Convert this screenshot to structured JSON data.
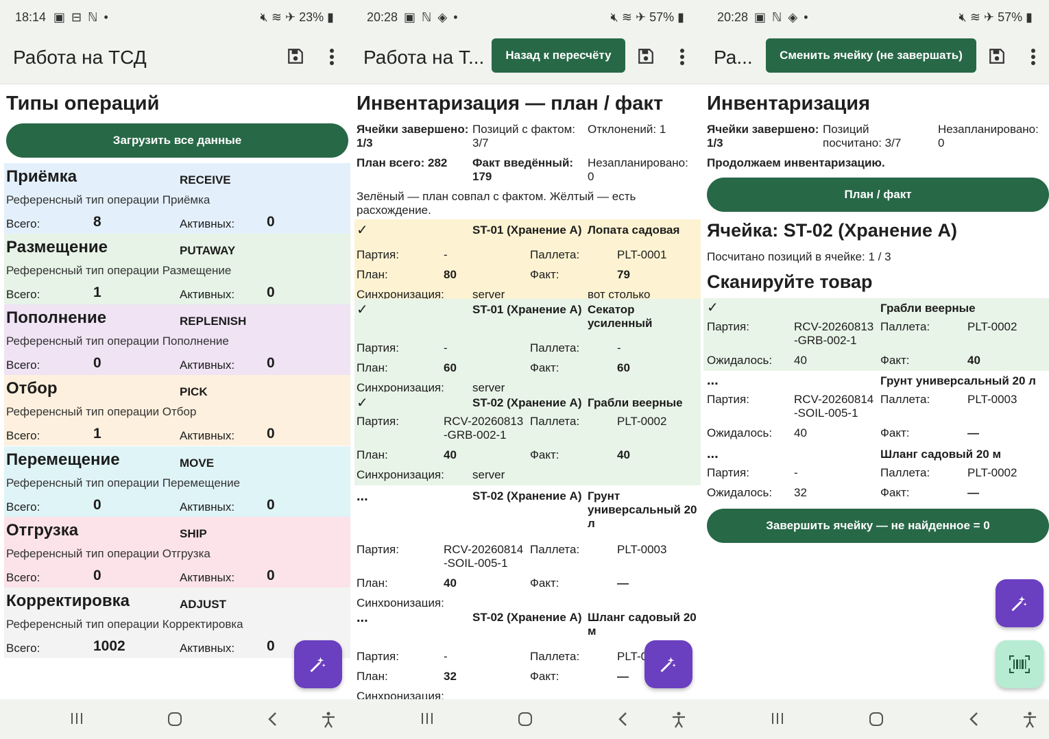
{
  "status": {
    "s1": {
      "time": "18:14",
      "battery": "23%"
    },
    "s2": {
      "time": "20:28",
      "battery": "57%"
    },
    "s3": {
      "time": "20:28",
      "battery": "57%"
    }
  },
  "screen1": {
    "title": "Работа на ТСД",
    "heading": "Типы операций",
    "load_button": "Загрузить все данные",
    "total_label": "Всего:",
    "active_label": "Активных:",
    "ops": [
      {
        "name": "Приёмка",
        "code": "RECEIVE",
        "desc": "Референсный тип операции Приёмка",
        "total": "8",
        "active": "0",
        "color": "#e3f0fb"
      },
      {
        "name": "Размещение",
        "code": "PUTAWAY",
        "desc": "Референсный тип операции Размещение",
        "total": "1",
        "active": "0",
        "color": "#e6f3e6"
      },
      {
        "name": "Пополнение",
        "code": "REPLENISH",
        "desc": "Референсный тип операции Пополнение",
        "total": "0",
        "active": "0",
        "color": "#efe3f4"
      },
      {
        "name": "Отбор",
        "code": "PICK",
        "desc": "Референсный тип операции Отбор",
        "total": "1",
        "active": "0",
        "color": "#fdf0de"
      },
      {
        "name": "Перемещение",
        "code": "MOVE",
        "desc": "Референсный тип операции Перемещение",
        "total": "0",
        "active": "0",
        "color": "#dff4f6"
      },
      {
        "name": "Отгрузка",
        "code": "SHIP",
        "desc": "Референсный тип операции Отгрузка",
        "total": "0",
        "active": "0",
        "color": "#fbe3e9"
      },
      {
        "name": "Корректировка",
        "code": "ADJUST",
        "desc": "Референсный тип операции Корректировка",
        "total": "1002",
        "active": "0",
        "color": "#f3f3f3"
      }
    ]
  },
  "screen2": {
    "title": "Работа на Т...",
    "back_button": "Назад к пересчёту",
    "heading": "Инвентаризация — план / факт",
    "summary": {
      "cells_label": "Ячейки завершено:",
      "cells_value": "1/3",
      "fact_pos_label": "Позиций с фактом:",
      "fact_pos_value": "3/7",
      "dev_label": "Отклонений: 1",
      "plan_total": "План всего: 282",
      "fact_label": "Факт введённый:",
      "fact_value": "179",
      "unplanned_label": "Незапланировано:",
      "unplanned_value": "0"
    },
    "legend": "Зелёный — план совпал с фактом. Жёлтый — есть расхождение.",
    "labels": {
      "party": "Партия:",
      "pallet": "Паллета:",
      "plan": "План:",
      "fact": "Факт:",
      "sync": "Синхронизация:"
    },
    "items": [
      {
        "mark": "✓",
        "cell": "ST-01 (Хранение А)",
        "product": "Лопата садовая",
        "party": "-",
        "pallet": "PLT-0001",
        "plan": "80",
        "fact": "79",
        "sync": "server",
        "note": "вот столько"
      },
      {
        "mark": "✓",
        "cell": "ST-01 (Хранение А)",
        "product": "Секатор усиленный",
        "party": "-",
        "pallet": "-",
        "plan": "60",
        "fact": "60",
        "sync": "server",
        "note": ""
      },
      {
        "mark": "✓",
        "cell": "ST-02 (Хранение А)",
        "product": "Грабли веерные",
        "party": "RCV-20260813 -GRB-002-1",
        "pallet": "PLT-0002",
        "plan": "40",
        "fact": "40",
        "sync": "server",
        "note": ""
      },
      {
        "mark": "...",
        "cell": "ST-02 (Хранение А)",
        "product": "Грунт универсальный 20 л",
        "party": "RCV-20260814 -SOIL-005-1",
        "pallet": "PLT-0003",
        "plan": "40",
        "fact": "—",
        "sync": "",
        "note": ""
      },
      {
        "mark": "...",
        "cell": "ST-02 (Хранение А)",
        "product": "Шланг садовый 20 м",
        "party": "-",
        "pallet": "PLT-0",
        "plan": "32",
        "fact": "—",
        "sync": "",
        "note": ""
      }
    ]
  },
  "screen3": {
    "title": "Ра...",
    "change_button": "Сменить ячейку (не завершать)",
    "heading": "Инвентаризация",
    "cells_label": "Ячейки завершено:",
    "cells_value": "1/3",
    "counted_label": "Позиций посчитано: 3/7",
    "unplanned_label": "Незапланировано:",
    "unplanned_value": "0",
    "continue_text": "Продолжаем инвентаризацию.",
    "planfact_button": "План / факт",
    "cell_title": "Ячейка: ST-02 (Хранение А)",
    "counted_in_cell": "Посчитано позиций в ячейке: 1 / 3",
    "scan_title": "Сканируйте товар",
    "labels": {
      "party": "Партия:",
      "pallet": "Паллета:",
      "expected": "Ожидалось:",
      "fact": "Факт:"
    },
    "items": [
      {
        "mark": "✓",
        "product": "Грабли веерные",
        "party": "RCV-20260813 -GRB-002-1",
        "pallet": "PLT-0002",
        "expected": "40",
        "fact": "40"
      },
      {
        "mark": "...",
        "product": "Грунт универсальный 20 л",
        "party": "RCV-20260814 -SOIL-005-1",
        "pallet": "PLT-0003",
        "expected": "40",
        "fact": "—"
      },
      {
        "mark": "...",
        "product": "Шланг садовый 20 м",
        "party": "-",
        "pallet": "PLT-0002",
        "expected": "32",
        "fact": "—"
      }
    ],
    "finish_button": "Завершить ячейку — не найденное = 0"
  },
  "icons": {
    "save": "save-icon",
    "more": "more-vert-icon",
    "magic": "magic-wand-icon",
    "barcode": "barcode-scan-icon",
    "nav_recents": "recents-icon",
    "nav_home": "home-icon",
    "nav_back": "back-icon",
    "nav_accessibility": "accessibility-icon"
  },
  "colors": {
    "primary": "#276847",
    "fab": "#6a3fc0",
    "fab_scan": "#b8ecd2",
    "match": "#e8f4e8",
    "mismatch": "#fdf3d2"
  }
}
